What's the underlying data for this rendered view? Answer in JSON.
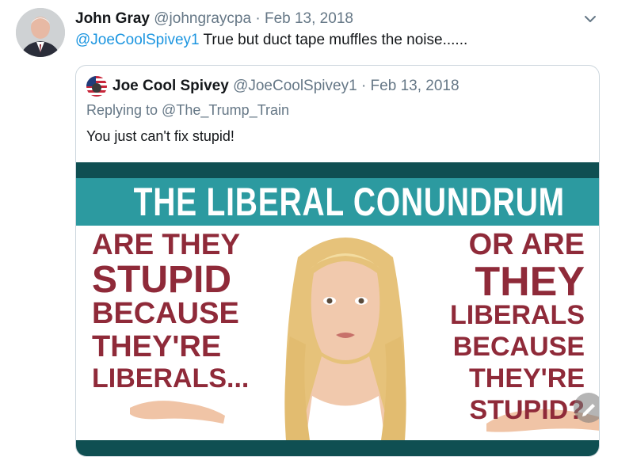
{
  "tweet": {
    "author_name": "John Gray",
    "author_handle": "@johngraycpa",
    "separator": "·",
    "date": "Feb 13, 2018",
    "reply_mention": "@JoeCoolSpivey1",
    "text": " True but duct tape muffles the noise......"
  },
  "quoted_tweet": {
    "author_name": "Joe Cool Spivey",
    "author_handle": "@JoeCoolSpivey1",
    "separator": "·",
    "date": "Feb 13, 2018",
    "replying_to": "Replying to @The_Trump_Train",
    "text": "You just can't fix stupid!"
  },
  "meme": {
    "title": "THE LIBERAL CONUNDRUM",
    "left_lines": [
      "ARE THEY",
      "STUPID",
      "BECAUSE",
      "THEY'RE",
      "LIBERALS..."
    ],
    "right_lines": [
      "OR ARE",
      "THEY",
      "LIBERALS",
      "BECAUSE",
      "THEY'RE",
      "STUPID?"
    ]
  },
  "icons": {
    "more": "chevron-down-icon",
    "edit": "pencil-icon"
  },
  "colors": {
    "link": "#1b95e0",
    "muted": "#657786",
    "meme_teal": "#2c9aa0",
    "meme_dark": "#0f4f52",
    "meme_red": "#8f2a39"
  }
}
